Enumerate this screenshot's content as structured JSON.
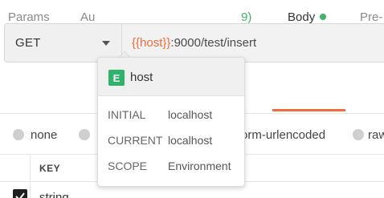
{
  "request": {
    "method": "GET",
    "url_var": "{{host}}",
    "url_rest": ":9000/test/insert"
  },
  "tabs": {
    "params": "Params",
    "auth": "Au",
    "count": "9)",
    "body": "Body",
    "pre": "Pre-"
  },
  "body_types": {
    "none": "none",
    "urlencoded": "orm-urlencoded",
    "raw": "raw"
  },
  "table": {
    "key_header": "KEY",
    "row_key": "string"
  },
  "popover": {
    "badge": "E",
    "variable": "host",
    "rows": [
      {
        "label": "INITIAL",
        "value": "localhost"
      },
      {
        "label": "CURRENT",
        "value": "localhost"
      },
      {
        "label": "SCOPE",
        "value": "Environment"
      }
    ]
  },
  "colors": {
    "accent": "#f26b3a",
    "env_green": "#2fb36a"
  }
}
